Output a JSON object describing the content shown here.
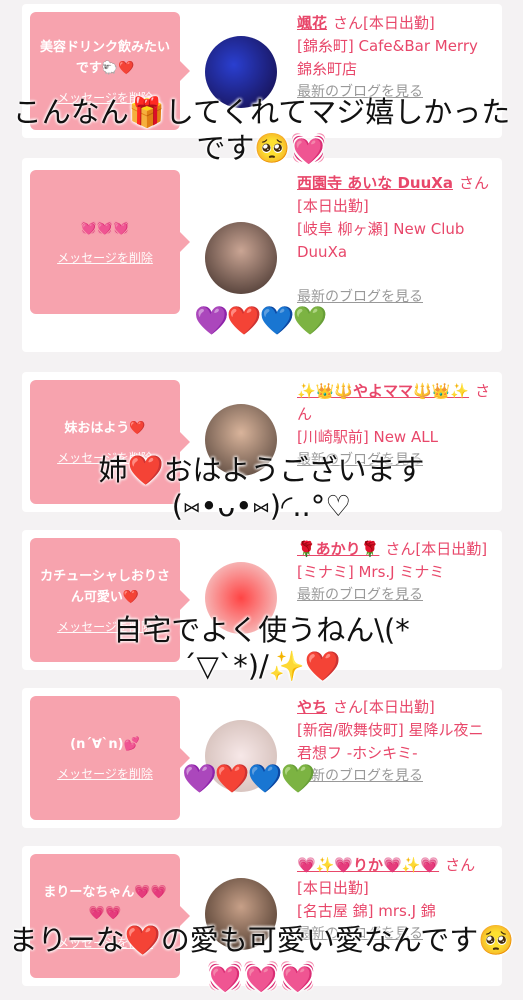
{
  "delete_label": "メッセージを削除",
  "blog_label": "最新のブログを見る",
  "cards": [
    {
      "message": "美容ドリンク飲みたいです🐑❤️",
      "name": "颯花",
      "san": "さん[本日出勤]",
      "shop": "[錦糸町] Cafe&Bar Merry 錦糸町店"
    },
    {
      "message": "💓💓💓",
      "name": "西園寺 あいな DuuXa",
      "san": "さん[本日出勤]",
      "shop": "[岐阜 柳ヶ瀬] New Club DuuXa"
    },
    {
      "message": "妹おはよう❤️",
      "name": "✨👑🔱やよママ🔱👑✨",
      "san": "さん",
      "shop": "[川崎駅前] New ALL"
    },
    {
      "message": "カチューシャしおりさん可愛い❤️",
      "name": "🌹あかり🌹",
      "san": "さん[本日出勤]",
      "shop": "[ミナミ] Mrs.J ミナミ"
    },
    {
      "message": "(n´∀`n)💕",
      "name": "やち",
      "san": "さん[本日出勤]",
      "shop": "[新宿/歌舞伎町] 星降ル夜ニ君想フ -ホシキミ-"
    },
    {
      "message": "まりーなちゃん💗💗💗💗",
      "name": "💗✨💗りか💗✨💗",
      "san": "さん[本日出勤]",
      "shop": "[名古屋 錦] mrs.J 錦"
    }
  ],
  "overlays": {
    "o1": "こんなん🎁してくれてマジ嬉しかったです🥺💓",
    "o2": "姉❤️おはようございます(⑅•ᴗ•⑅)◜..°♡",
    "o3": "自宅でよく使うねん\\(*´▽`*)/✨❤️",
    "o4": "まりーな❤️の愛も可愛い愛なんです🥺💓💓💓"
  },
  "hearts": "💜❤️💙💚",
  "colors": {
    "accent": "#e8476a",
    "bubble": "#f7a3ae"
  }
}
